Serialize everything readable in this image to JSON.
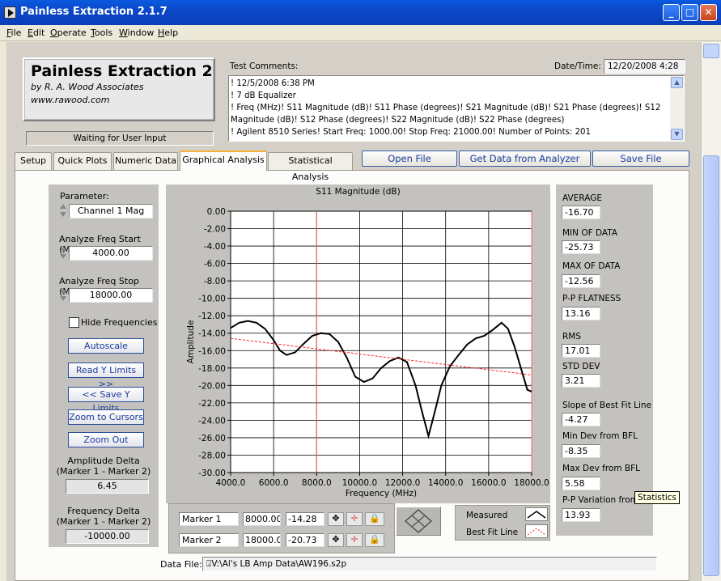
{
  "window": {
    "title": "Painless Extraction 2.1.7",
    "buttons": {
      "minimize": "_",
      "maximize": "□",
      "close": "✕"
    }
  },
  "menu": [
    {
      "u": "F",
      "rest": "ile"
    },
    {
      "u": "E",
      "rest": "dit"
    },
    {
      "u": "O",
      "rest": "perate"
    },
    {
      "u": "T",
      "rest": "ools"
    },
    {
      "u": "W",
      "rest": "indow"
    },
    {
      "u": "H",
      "rest": "elp"
    }
  ],
  "logo": {
    "title": "Painless Extraction 2",
    "by": "by R. A. Wood Associates",
    "web": "www.rawood.com"
  },
  "status": "Waiting for User Input",
  "comments": {
    "label": "Test Comments:",
    "text": "! 12/5/2008 6:38 PM\n! 7 dB Equalizer\n! Freq (MHz)! S11 Magnitude (dB)! S11 Phase (degrees)! S21 Magnitude (dB)! S21 Phase (degrees)! S12 Magnitude (dB)! S12 Phase (degrees)! S22 Magnitude (dB)! S22 Phase (degrees)\n! Agilent 8510 Series! Start Freq: 1000.00! Stop Freq: 21000.00! Number of Points: 201",
    "scroll_up": "▲",
    "scroll_down": "▼"
  },
  "datetime": {
    "label": "Date/Time:",
    "value": "12/20/2008  4:28"
  },
  "tabs": [
    "Setup",
    "Quick Plots",
    "Numeric Data",
    "Graphical Analysis",
    "Statistical Analysis"
  ],
  "active_tab": "Graphical Analysis",
  "top_buttons": {
    "open": "Open File",
    "get": "Get Data from Analyzer",
    "save": "Save File"
  },
  "left": {
    "parameter_label": "Parameter:",
    "parameter_value": "Channel 1 Mag",
    "start_label": "Analyze Freq Start (MHz)",
    "start_value": "4000.00",
    "stop_label": "Analyze Freq Stop (MHz)",
    "stop_value": "18000.00",
    "hide_label": "Hide Frequencies",
    "autoscale": "Autoscale",
    "read_y": "Read Y Limits >>",
    "save_y": "<< Save Y Limits",
    "zoom_cursors": "Zoom to Cursors",
    "zoom_out": "Zoom Out",
    "amp_delta_label1": "Amplitude Delta",
    "amp_delta_label2": "(Marker 1 - Marker 2)",
    "amp_delta_value": "6.45",
    "freq_delta_label1": "Frequency Delta",
    "freq_delta_label2": "(Marker 1 - Marker 2)",
    "freq_delta_value": "-10000.00"
  },
  "chart_data": {
    "type": "line",
    "title": "S11 Magnitude (dB)",
    "xlabel": "Frequency (MHz)",
    "ylabel": "Amplitude",
    "xlim": [
      4000,
      18000
    ],
    "ylim": [
      -30,
      0
    ],
    "xticks": [
      4000,
      6000,
      8000,
      10000,
      12000,
      14000,
      16000,
      18000
    ],
    "yticks": [
      0,
      -2,
      -4,
      -6,
      -8,
      -10,
      -12,
      -14,
      -16,
      -18,
      -20,
      -22,
      -24,
      -26,
      -28,
      -30
    ],
    "grid": true,
    "series": [
      {
        "name": "Measured",
        "color": "#000000",
        "x": [
          4000,
          4400,
          4800,
          5200,
          5600,
          6000,
          6300,
          6600,
          7000,
          7400,
          7800,
          8200,
          8600,
          9000,
          9400,
          9800,
          10200,
          10600,
          11000,
          11400,
          11800,
          12200,
          12600,
          12900,
          13200,
          13500,
          13800,
          14200,
          14600,
          15000,
          15400,
          15800,
          16200,
          16600,
          16900,
          17200,
          17500,
          17800,
          18000
        ],
        "y": [
          -13.4,
          -12.8,
          -12.6,
          -12.8,
          -13.5,
          -14.8,
          -16.0,
          -16.5,
          -16.2,
          -15.2,
          -14.3,
          -14.0,
          -14.1,
          -15.0,
          -16.8,
          -19.0,
          -19.6,
          -19.2,
          -18.0,
          -17.2,
          -16.8,
          -17.3,
          -20.0,
          -23.0,
          -25.8,
          -23.0,
          -20.0,
          -17.8,
          -16.5,
          -15.3,
          -14.6,
          -14.3,
          -13.6,
          -12.8,
          -13.5,
          -15.5,
          -18.0,
          -20.5,
          -20.7
        ]
      },
      {
        "name": "Best Fit Line",
        "color": "#ff2020",
        "x": [
          4000,
          18000
        ],
        "y": [
          -14.6,
          -18.8
        ]
      }
    ],
    "markers": [
      8000,
      18000
    ],
    "marker_color": "#ff6060"
  },
  "markers": [
    {
      "name": "Marker 1",
      "freq": "8000.00",
      "amp": "-14.28"
    },
    {
      "name": "Marker 2",
      "freq": "18000.00",
      "amp": "-20.73"
    }
  ],
  "legend": {
    "measured": "Measured",
    "bestfit": "Best Fit Line"
  },
  "stats": [
    {
      "label": "AVERAGE",
      "value": "-16.70"
    },
    {
      "label": "MIN OF DATA",
      "value": "-25.73"
    },
    {
      "label": "MAX OF DATA",
      "value": "-12.56"
    },
    {
      "label": "P-P FLATNESS",
      "value": "13.16"
    },
    {
      "label": "RMS",
      "value": "17.01"
    },
    {
      "label": "STD DEV",
      "value": "3.21"
    },
    {
      "label": "Slope of Best Fit Line",
      "value": "-4.27"
    },
    {
      "label": "Min Dev from BFL",
      "value": "-8.35"
    },
    {
      "label": "Max Dev from BFL",
      "value": "5.58"
    },
    {
      "label": "P-P Variation from",
      "value": "13.93"
    }
  ],
  "tooltip": "Statistics",
  "datafile": {
    "label": "Data File:",
    "value": "V:\\Al's LB Amp Data\\AW196.s2p"
  }
}
